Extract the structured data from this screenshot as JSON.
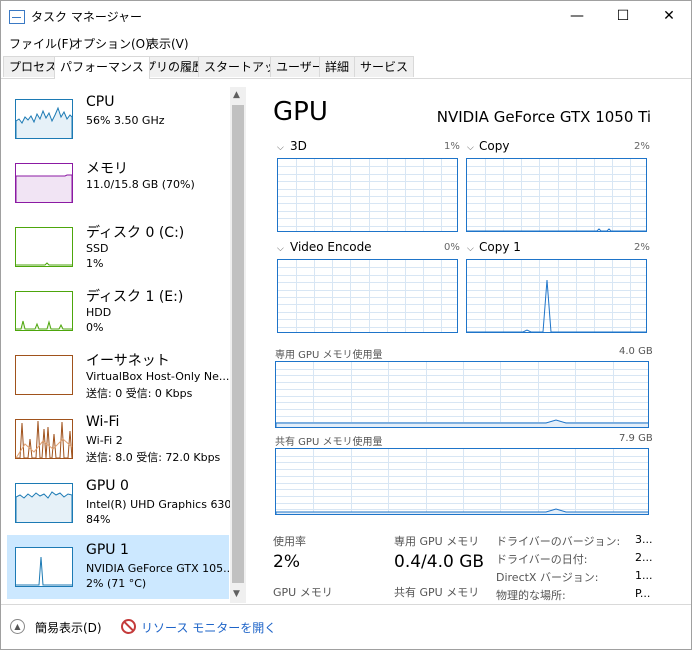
{
  "window": {
    "title": "タスク マネージャー",
    "minimize": "—",
    "maximize": "☐",
    "close": "✕"
  },
  "menu": [
    "ファイル(F)",
    "オプション(O)",
    "表示(V)"
  ],
  "tabs": [
    "プロセス",
    "パフォーマンス",
    "アプリの履歴",
    "スタートアップ",
    "ユーザー",
    "詳細",
    "サービス"
  ],
  "active_tab": 1,
  "resources": [
    {
      "name": "CPU",
      "line1": "56%  3.50 GHz",
      "line2": "",
      "color": "#1c7ab4"
    },
    {
      "name": "メモリ",
      "line1": "11.0/15.8 GB (70%)",
      "line2": "",
      "color": "#8b1aa3"
    },
    {
      "name": "ディスク 0 (C:)",
      "line1": "SSD",
      "line2": "1%",
      "color": "#4da60c"
    },
    {
      "name": "ディスク 1 (E:)",
      "line1": "HDD",
      "line2": "0%",
      "color": "#4da60c"
    },
    {
      "name": "イーサネット",
      "line1": "VirtualBox Host-Only Ne...",
      "line2": "送信: 0  受信: 0 Kbps",
      "color": "#a0521c"
    },
    {
      "name": "Wi-Fi",
      "line1": "Wi-Fi 2",
      "line2": "送信: 8.0  受信: 72.0 Kbps",
      "color": "#a0521c"
    },
    {
      "name": "GPU 0",
      "line1": "Intel(R) UHD Graphics 630",
      "line2": "84%",
      "color": "#1c7ab4"
    },
    {
      "name": "GPU 1",
      "line1": "NVIDIA GeForce GTX 105...",
      "line2": "2%  (71 °C)",
      "color": "#1c7ab4"
    }
  ],
  "selected_resource": 7,
  "detail": {
    "title": "GPU",
    "device": "NVIDIA GeForce GTX 1050 Ti",
    "engines": [
      {
        "label": "3D",
        "pct": "1%"
      },
      {
        "label": "Copy",
        "pct": "2%"
      },
      {
        "label": "Video Encode",
        "pct": "0%"
      },
      {
        "label": "Copy 1",
        "pct": "2%"
      }
    ],
    "dedicated_label": "専用 GPU メモリ使用量",
    "dedicated_max": "4.0 GB",
    "shared_label": "共有 GPU メモリ使用量",
    "shared_max": "7.9 GB",
    "stats": {
      "usage_label": "使用率",
      "usage_value": "2%",
      "gpu_mem_label": "GPU メモリ",
      "dedicated_mem_label": "専用 GPU メモリ",
      "dedicated_mem_value": "0.4/4.0 GB",
      "shared_mem_label": "共有 GPU メモリ"
    },
    "info": [
      {
        "label": "ドライバーのバージョン:",
        "value": "3..."
      },
      {
        "label": "ドライバーの日付:",
        "value": "2..."
      },
      {
        "label": "DirectX バージョン:",
        "value": "1..."
      },
      {
        "label": "物理的な場所:",
        "value": "P..."
      }
    ]
  },
  "footer": {
    "fewer_details": "簡易表示(D)",
    "resource_monitor": "リソース モニターを開く"
  }
}
